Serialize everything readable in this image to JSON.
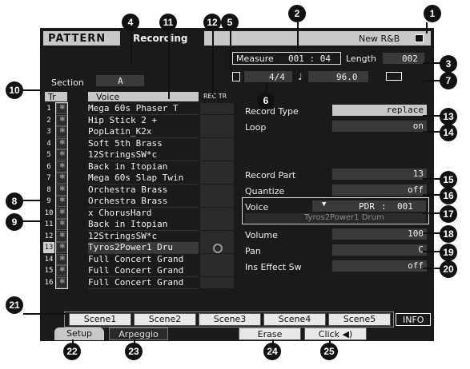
{
  "header": {
    "mode": "PATTERN",
    "screen": "Recording",
    "pattern_name": "New R&B",
    "measure_label": "Measure",
    "measure_value": "001 : 04",
    "length_label": "Length",
    "length_value": "002",
    "section_label": "Section",
    "section_value": "A",
    "time_signature": "4/4",
    "tempo": "96.0"
  },
  "track_table": {
    "col_tr": "Tr",
    "col_voice": "Voice",
    "col_rectr": "REC TR",
    "rows": [
      {
        "num": "1",
        "voice": "Mega 60s Phaser T"
      },
      {
        "num": "2",
        "voice": "Hip Stick 2 +"
      },
      {
        "num": "3",
        "voice": "PopLatin_K2x"
      },
      {
        "num": "4",
        "voice": "Soft 5th Brass"
      },
      {
        "num": "5",
        "voice": "12StringsSW*c"
      },
      {
        "num": "6",
        "voice": "Back in Itopian"
      },
      {
        "num": "7",
        "voice": "Mega 60s Slap Twin"
      },
      {
        "num": "8",
        "voice": "Orchestra Brass"
      },
      {
        "num": "9",
        "voice": "Orchestra Brass"
      },
      {
        "num": "10",
        "voice": "x ChorusHard"
      },
      {
        "num": "11",
        "voice": "Back in Itopian"
      },
      {
        "num": "12",
        "voice": "12StringsSW*c"
      },
      {
        "num": "13",
        "voice": "Tyros2Power1 Dru"
      },
      {
        "num": "14",
        "voice": "Full Concert Grand"
      },
      {
        "num": "15",
        "voice": "Full Concert Grand"
      },
      {
        "num": "16",
        "voice": "Full Concert Grand"
      }
    ],
    "selected_track": "13"
  },
  "params": {
    "record_type_label": "Record Type",
    "record_type_value": "replace",
    "loop_label": "Loop",
    "loop_value": "on",
    "record_part_label": "Record Part",
    "record_part_value": "13",
    "quantize_label": "Quantize",
    "quantize_value": "off",
    "voice_label": "Voice",
    "voice_bank": "PDR",
    "voice_number": "001",
    "voice_name": "Tyros2Power1 Drum",
    "volume_label": "Volume",
    "volume_value": "100",
    "pan_label": "Pan",
    "pan_value": "C",
    "ins_effect_label": "Ins Effect Sw",
    "ins_effect_value": "off"
  },
  "scenes": [
    "Scene1",
    "Scene2",
    "Scene3",
    "Scene4",
    "Scene5"
  ],
  "info_button": "INFO",
  "tabs": {
    "setup": "Setup",
    "arpeggio": "Arpeggio",
    "erase": "Erase",
    "click": "Click ◀)"
  },
  "callouts": [
    "1",
    "2",
    "3",
    "4",
    "5",
    "6",
    "7",
    "8",
    "9",
    "10",
    "11",
    "12",
    "13",
    "14",
    "15",
    "16",
    "17",
    "18",
    "19",
    "20",
    "21",
    "22",
    "23",
    "24",
    "25"
  ]
}
